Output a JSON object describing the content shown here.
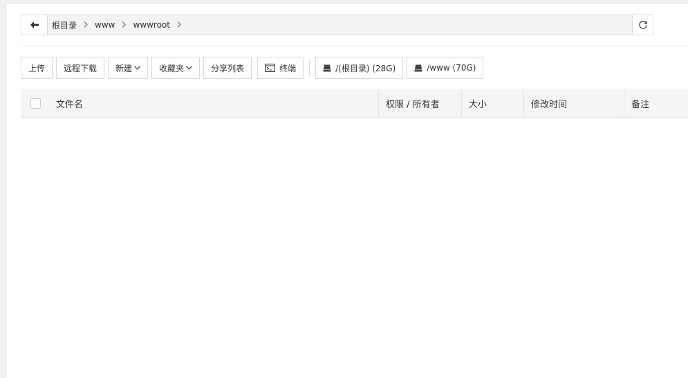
{
  "path": {
    "crumbs": [
      "根目录",
      "www",
      "wwwroot"
    ]
  },
  "toolbar": {
    "upload": "上传",
    "remote_download": "远程下载",
    "new": "新建",
    "favorites": "收藏夹",
    "share_list": "分享列表",
    "terminal": "终端",
    "disk_root": "/(根目录) (28G)",
    "disk_www": "/www (70G)"
  },
  "table": {
    "columns": [
      "文件名",
      "权限 / 所有者",
      "大小",
      "修改时间",
      "备注"
    ]
  }
}
